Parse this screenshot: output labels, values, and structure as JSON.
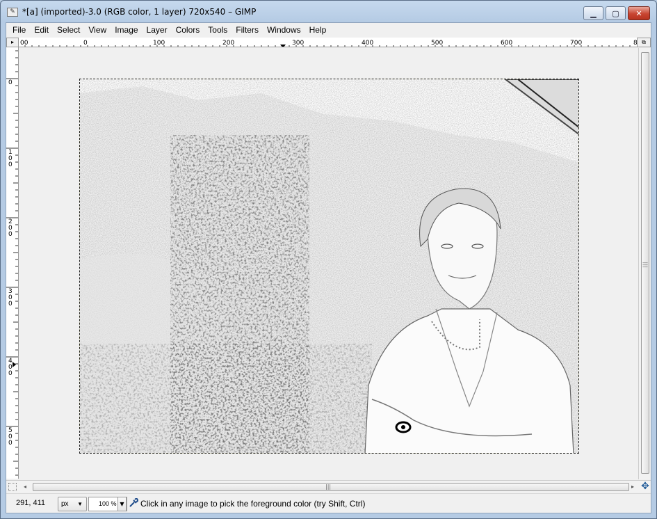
{
  "window": {
    "title": "*[a] (imported)-3.0 (RGB color, 1 layer) 720x540 – GIMP",
    "min_label": "▭",
    "max_label": "▢",
    "close_label": "✕"
  },
  "menubar": {
    "items": [
      "File",
      "Edit",
      "Select",
      "View",
      "Image",
      "Layer",
      "Colors",
      "Tools",
      "Filters",
      "Windows",
      "Help"
    ]
  },
  "hruler": {
    "labels": [
      "00",
      "0",
      "100",
      "200",
      "300",
      "400",
      "500",
      "600",
      "700",
      "8"
    ]
  },
  "vruler": {
    "labels": [
      "0",
      "1 0 0",
      "2 0 0",
      "3 0 0",
      "4 0 0",
      "5 0 0"
    ]
  },
  "status": {
    "coords": "291, 411",
    "unit": "px",
    "zoom": "100 %",
    "message": "Click in any image to pick the foreground color (try Shift, Ctrl)"
  },
  "icons": {
    "picker": "color-picker-icon",
    "navigate": "navigate-icon"
  }
}
